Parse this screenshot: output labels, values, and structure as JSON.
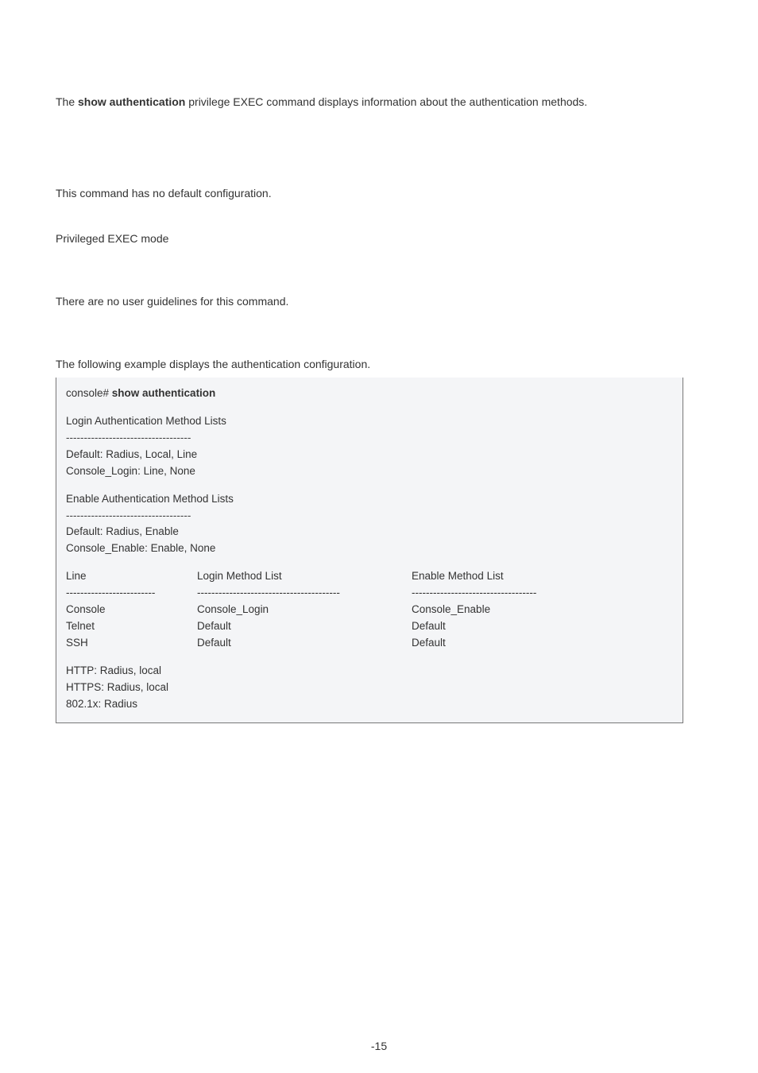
{
  "intro": {
    "prefix": "The ",
    "cmd": "show authentication",
    "rest": " privilege EXEC command displays information about the authentication methods."
  },
  "default_cfg": {
    "text": "This command has no default configuration."
  },
  "mode": {
    "text": "Privileged EXEC mode"
  },
  "guidelines": {
    "text": "There are no user guidelines for this command."
  },
  "example_lead": {
    "text": "The following example displays the authentication configuration."
  },
  "console": {
    "prompt": "console#",
    "cmd": " show authentication",
    "login_heading": "Login Authentication Method Lists",
    "sep1": "-----------------------------------",
    "login_default": "Default: Radius, Local, Line",
    "login_console": "Console_Login: Line, None",
    "enable_heading": "Enable Authentication Method Lists",
    "sep2": "-----------------------------------",
    "enable_default": "Default: Radius, Enable",
    "enable_console": "Console_Enable: Enable, None",
    "headers": {
      "line": "Line",
      "login": "Login Method List",
      "enable": "Enable Method List"
    },
    "dashes": {
      "c1": "-------------------------",
      "c2": "----------------------------------------",
      "c3": " -----------------------------------"
    },
    "rows": [
      {
        "c1": "Console",
        "c2": "Console_Login",
        "c3": "Console_Enable"
      },
      {
        "c1": "Telnet",
        "c2": "Default",
        "c3": "Default"
      },
      {
        "c1": "SSH",
        "c2": " Default",
        "c3": " Default"
      }
    ],
    "tail": {
      "http": "HTTP: Radius, local",
      "https": "HTTPS: Radius, local",
      "dot1x": "802.1x: Radius"
    }
  },
  "page_number": "-15"
}
